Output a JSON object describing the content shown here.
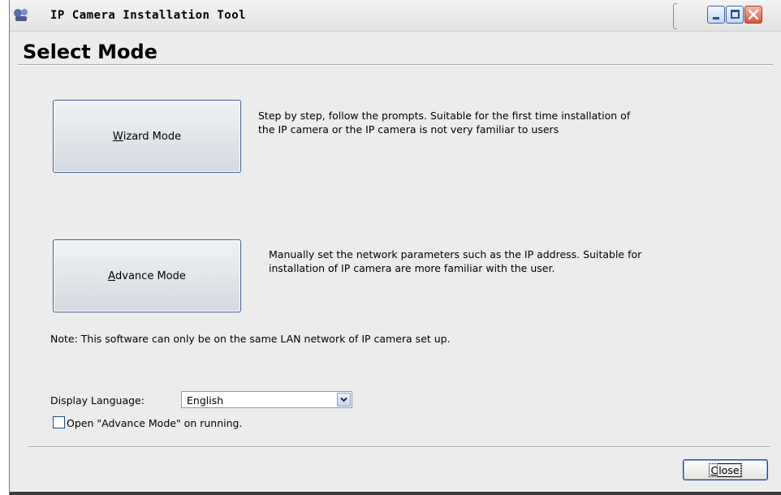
{
  "window": {
    "title": "IP Camera Installation Tool"
  },
  "page": {
    "heading": "Select Mode"
  },
  "modes": {
    "wizard": {
      "mnemonic": "W",
      "label_rest": "izard Mode",
      "description": "Step by step, follow the prompts. Suitable for the first time installation of the IP camera or the IP camera is not very familiar to users"
    },
    "advance": {
      "mnemonic": "A",
      "label_rest": "dvance Mode",
      "description": "Manually set the network parameters such as the IP address. Suitable for installation of IP camera are more familiar with the user."
    }
  },
  "note": "Note: This software can only be on the same LAN network of IP camera set up.",
  "language": {
    "label": "Display Language:",
    "selected": "English"
  },
  "startup_option": {
    "label": "Open \"Advance Mode\" on running.",
    "checked": false
  },
  "close_button": {
    "mnemonic": "C",
    "label_rest": "lose"
  },
  "icons": {
    "app": "app-icon",
    "minimize": "minimize-icon",
    "maximize": "maximize-icon",
    "close": "close-icon",
    "dropdown": "chevron-down-icon"
  }
}
